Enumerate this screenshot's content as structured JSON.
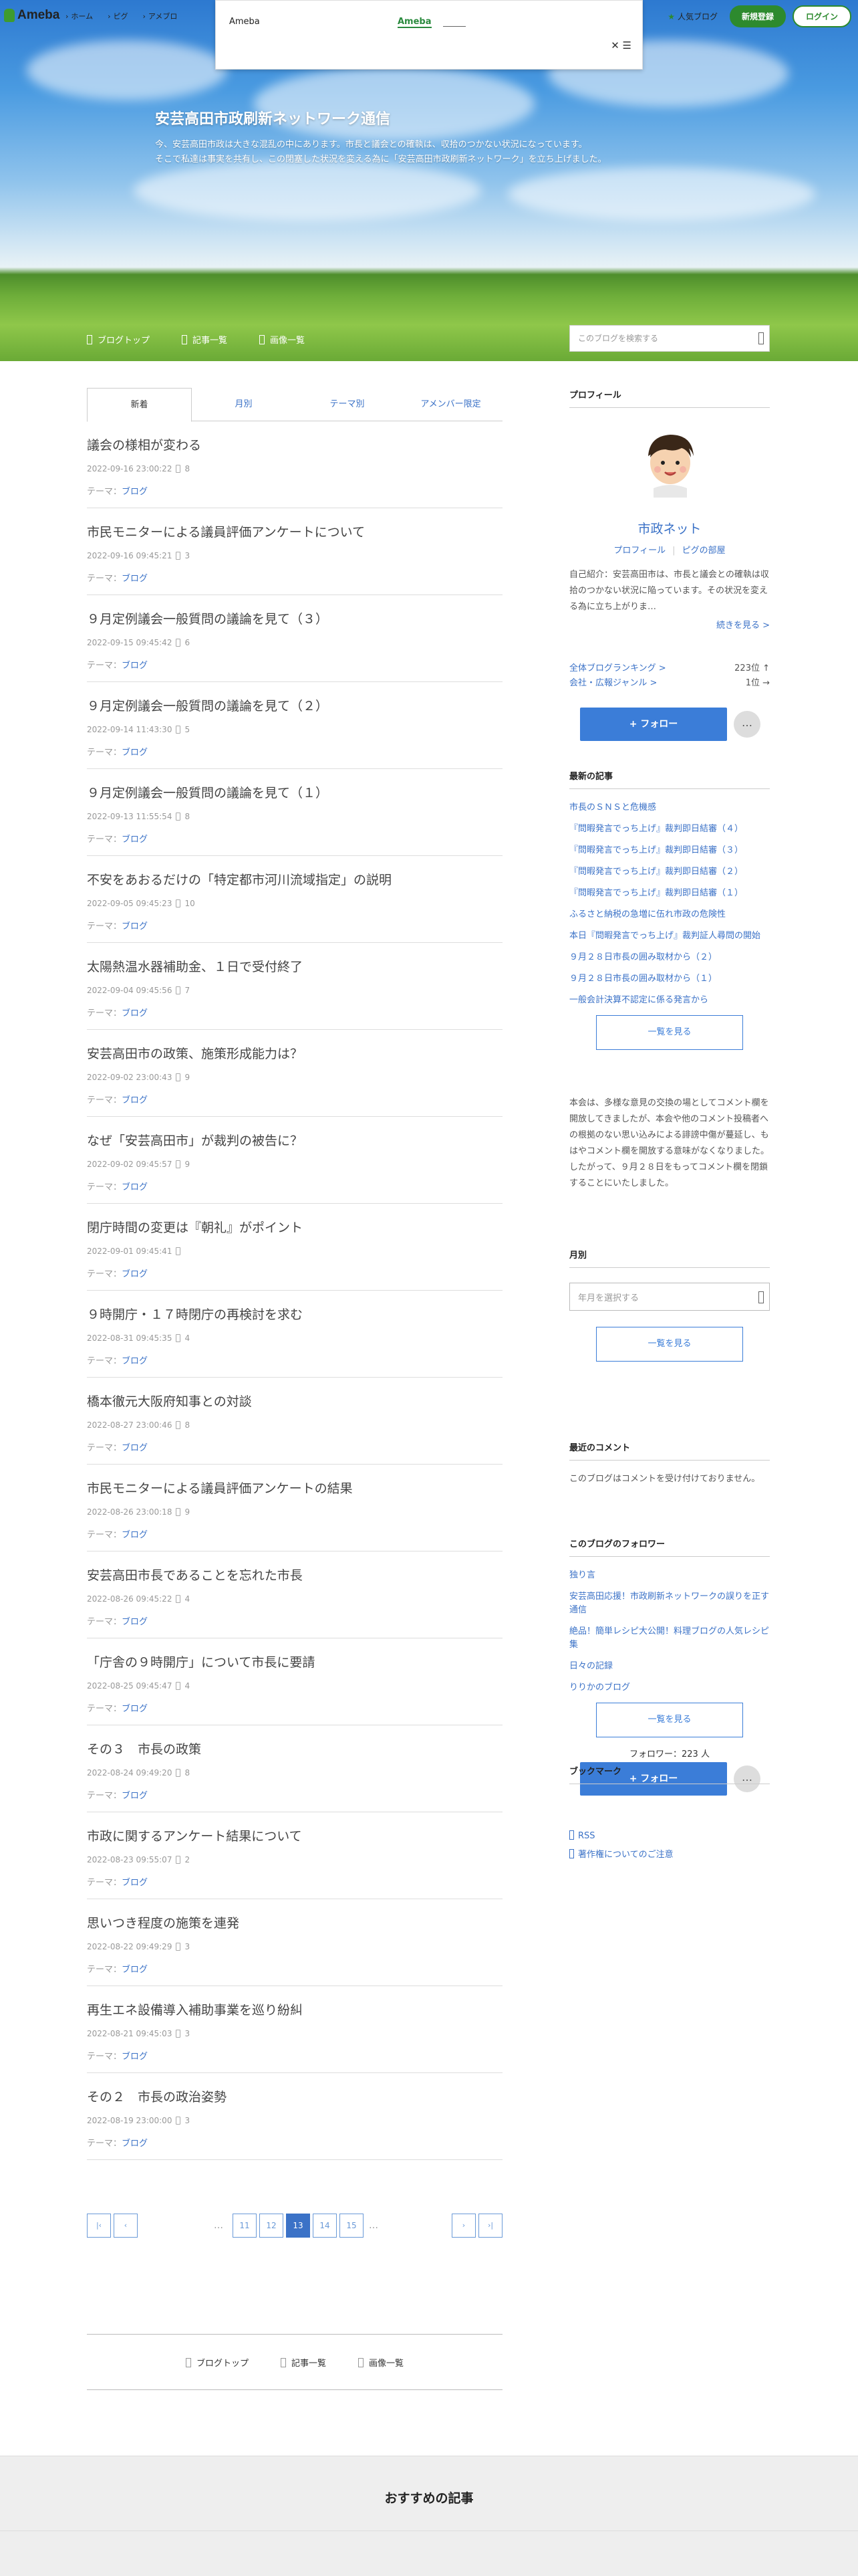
{
  "brand": {
    "logo": "Ameba"
  },
  "topnav": {
    "items": [
      "ホーム",
      "ピグ",
      "アメブロ"
    ]
  },
  "popup": {
    "name": "Ameba",
    "link": "Ameba",
    "close": "✕"
  },
  "header_right": {
    "popular": "人気ブログ",
    "signup": "新規登録",
    "login": "ログイン"
  },
  "blog": {
    "title": "安芸高田市政刷新ネットワーク通信",
    "desc1": "今、安芸高田市政は大きな混乱の中にあります。市長と議会との確執は、収拾のつかない状況になっています。",
    "desc2": "そこで私達は事実を共有し、この閉塞した状況を変える為に「安芸高田市政刷新ネットワーク」を立ち上げました。"
  },
  "nav": {
    "top": "ブログトップ",
    "list": "記事一覧",
    "images": "画像一覧",
    "search_placeholder": "このブログを検索する"
  },
  "tabs": [
    "新着",
    "月別",
    "テーマ別",
    "アメンバー限定"
  ],
  "entries": [
    {
      "title": "議会の様相が変わる",
      "date": "2022-09-16 23:00:22",
      "c": "8"
    },
    {
      "title": "市民モニターによる議員評価アンケートについて",
      "date": "2022-09-16 09:45:21",
      "c": "3"
    },
    {
      "title": "９月定例議会一般質問の議論を見て（３）",
      "date": "2022-09-15 09:45:42",
      "c": "6"
    },
    {
      "title": "９月定例議会一般質問の議論を見て（２）",
      "date": "2022-09-14 11:43:30",
      "c": "5"
    },
    {
      "title": "９月定例議会一般質問の議論を見て（１）",
      "date": "2022-09-13 11:55:54",
      "c": "8"
    },
    {
      "title": "不安をあおるだけの「特定都市河川流域指定」の説明",
      "date": "2022-09-05 09:45:23",
      "c": "10"
    },
    {
      "title": "太陽熱温水器補助金、１日で受付終了",
      "date": "2022-09-04 09:45:56",
      "c": "7"
    },
    {
      "title": "安芸高田市の政策、施策形成能力は？",
      "date": "2022-09-02 23:00:43",
      "c": "9"
    },
    {
      "title": "なぜ「安芸高田市」が裁判の被告に？",
      "date": "2022-09-02 09:45:57",
      "c": "9"
    },
    {
      "title": "閉庁時間の変更は『朝礼』がポイント",
      "date": "2022-09-01 09:45:41",
      "c": ""
    },
    {
      "title": "９時開庁・１７時閉庁の再検討を求む",
      "date": "2022-08-31 09:45:35",
      "c": "4"
    },
    {
      "title": "橋本徹元大阪府知事との対談",
      "date": "2022-08-27 23:00:46",
      "c": "8"
    },
    {
      "title": "市民モニターによる議員評価アンケートの結果",
      "date": "2022-08-26 23:00:18",
      "c": "9"
    },
    {
      "title": "安芸高田市長であることを忘れた市長",
      "date": "2022-08-26 09:45:22",
      "c": "4"
    },
    {
      "title": "「庁舎の９時開庁」について市長に要請",
      "date": "2022-08-25 09:45:47",
      "c": "4"
    },
    {
      "title": "その３　市長の政策",
      "date": "2022-08-24 09:49:20",
      "c": "8"
    },
    {
      "title": "市政に関するアンケート結果について",
      "date": "2022-08-23 09:55:07",
      "c": "2"
    },
    {
      "title": "思いつき程度の施策を連発",
      "date": "2022-08-22 09:49:29",
      "c": "3"
    },
    {
      "title": "再生エネ設備導入補助事業を巡り紛糾",
      "date": "2022-08-21 09:45:03",
      "c": "3"
    },
    {
      "title": "その２　市長の政治姿勢",
      "date": "2022-08-19 23:00:00",
      "c": "3"
    }
  ],
  "theme_label": "テーマ：",
  "theme_value": "ブログ",
  "pager": {
    "pages": [
      "11",
      "12",
      "13",
      "14",
      "15"
    ],
    "current": "13",
    "dots": "…"
  },
  "bottomnav": {
    "top": "ブログトップ",
    "list": "記事一覧",
    "images": "画像一覧"
  },
  "sidebar": {
    "profile_head": "プロフィール",
    "name": "市政ネット",
    "link_profile": "プロフィール",
    "link_pig": "ピグの部屋",
    "intro": "自己紹介：安芸高田市は、市長と議会との確執は収拾のつかない状況に陥っています。その状況を変える為に立ち上がりま…",
    "more": "続きを見る >",
    "rank1_label": "全体ブログランキング >",
    "rank1_val": "223位 ↑",
    "rank2_label": "会社・広報ジャンル >",
    "rank2_val": "1位 →",
    "follow": "+ フォロー",
    "more_btn": "…",
    "recent_head": "最新の記事",
    "recent": [
      "市長のＳＮＳと危機感",
      "『問暇発言でっち上げ』裁判即日結審（４）",
      "『問暇発言でっち上げ』裁判即日結審（３）",
      "『問暇発言でっち上げ』裁判即日結審（２）",
      "『問暇発言でっち上げ』裁判即日結審（１）",
      "ふるさと納税の急増に伍れ市政の危険性",
      "本日『問暇発言でっち上げ』裁判証人尋問の開始",
      "９月２８日市長の囲み取材から（２）",
      "９月２８日市長の囲み取材から（１）",
      "一般会計決算不認定に係る発言から"
    ],
    "list_btn": "一覧を見る",
    "notice": "本会は、多様な意見の交換の場としてコメント欄を開放してきましたが、本会や他のコメント投稿者への根拠のない思い込みによる誹謗中傷が蔓延し、もはやコメント欄を開放する意味がなくなりました。したがって、９月２８日をもってコメント欄を閉鎖することにいたしました。",
    "monthly_head": "月別",
    "monthly_placeholder": "年月を選択する",
    "comments_head": "最近のコメント",
    "comments_text": "このブログはコメントを受け付けておりません。",
    "followers_head": "このブログのフォロワー",
    "followers": [
      "独り言",
      "安芸高田応援！市政刷新ネットワークの誤りを正す通信",
      "絶品！簡単レシピ大公開！料理ブログの人気レシピ集",
      "日々の記録",
      "りりかのブログ"
    ],
    "follower_count": "フォロワー：223 人",
    "bookmark_head": "ブックマーク",
    "bookmarks": [
      "RSS",
      "著作権についてのご注意"
    ]
  },
  "recommend": {
    "title": "おすすめの記事"
  }
}
